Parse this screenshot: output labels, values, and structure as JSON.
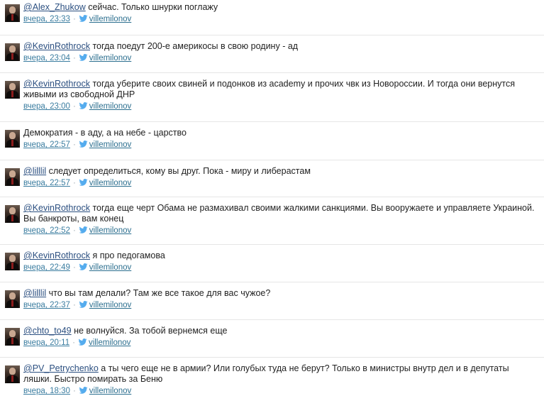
{
  "tweets": [
    {
      "mention": "@Alex_Zhukow",
      "text": " сейчас. Только шнурки поглажу",
      "time": "вчера, 23:33",
      "user": "villemilonov"
    },
    {
      "mention": "@KevinRothrock",
      "text": " тогда поедут 200-е америкосы в свою родину - ад",
      "time": "вчера, 23:04",
      "user": "villemilonov"
    },
    {
      "mention": "@KevinRothrock",
      "text": " тогда уберите своих свиней и подонков из academy и прочих чвк из Новороссии. И тогда они вернутся живыми из свободной ДНР",
      "time": "вчера, 23:00",
      "user": "villemilonov"
    },
    {
      "mention": "",
      "text": "Демократия - в аду, а на небе - царство",
      "time": "вчера, 22:57",
      "user": "villemilonov"
    },
    {
      "mention": "@lilllil",
      "text": " следует определиться, кому вы друг. Пока - миру и либерастам",
      "time": "вчера, 22:57",
      "user": "villemilonov"
    },
    {
      "mention": "@KevinRothrock",
      "text": " тогда еще черт Обама не размахивал своими жалкими санкциями. Вы вооружаете и управляете Украиной. Вы банкроты, вам конец",
      "time": "вчера, 22:52",
      "user": "villemilonov"
    },
    {
      "mention": "@KevinRothrock",
      "text": " я про педогамова",
      "time": "вчера, 22:49",
      "user": "villemilonov"
    },
    {
      "mention": "@lilllil",
      "text": " что вы там делали? Там же все такое для вас чужое?",
      "time": "вчера, 22:37",
      "user": "villemilonov"
    },
    {
      "mention": "@chto_to49",
      "text": " не волнуйся. За тобой вернемся еще",
      "time": "вчера, 20:11",
      "user": "villemilonov"
    },
    {
      "mention": "@PV_Petrychenko",
      "text": " а ты чего еще не в армии? Или голубых туда не берут? Только в министры внутр дел и в депутаты ляшки. Быстро помирать за Беню",
      "time": "вчера, 18:30",
      "user": "villemilonov"
    }
  ],
  "icons": {
    "avatar": "user-avatar-photo",
    "bird": "twitter-bird-icon"
  },
  "colors": {
    "link": "#2b4f80",
    "meta": "#2c6f8f",
    "bird": "#55acee"
  }
}
